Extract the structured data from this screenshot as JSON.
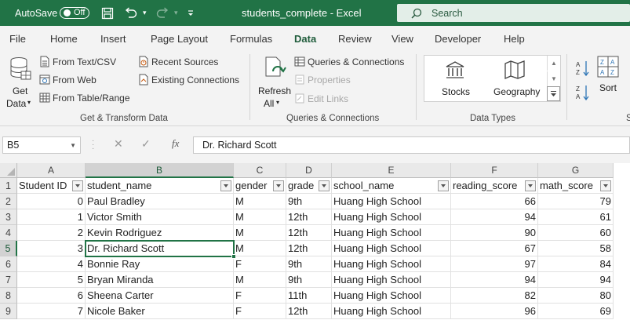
{
  "titlebar": {
    "autosave_label": "AutoSave",
    "autosave_state": "Off",
    "doc_title": "students_complete  -  Excel",
    "search_placeholder": "Search"
  },
  "tabs": [
    "File",
    "Home",
    "Insert",
    "Page Layout",
    "Formulas",
    "Data",
    "Review",
    "View",
    "Developer",
    "Help"
  ],
  "active_tab": "Data",
  "ribbon": {
    "get_data": {
      "line1": "Get",
      "line2": "Data"
    },
    "from_text_csv": "From Text/CSV",
    "from_web": "From Web",
    "from_table_range": "From Table/Range",
    "recent_sources": "Recent Sources",
    "existing_connections": "Existing Connections",
    "group_get_transform": "Get & Transform Data",
    "refresh": {
      "line1": "Refresh",
      "line2": "All"
    },
    "queries_connections": "Queries & Connections",
    "properties": "Properties",
    "edit_links": "Edit Links",
    "group_queries": "Queries & Connections",
    "stocks": "Stocks",
    "geography": "Geography",
    "group_datatypes": "Data Types",
    "sort": "Sort",
    "group_sort_partial": "S"
  },
  "formula_bar": {
    "name_box": "B5",
    "fx": "fx",
    "content": "Dr. Richard Scott"
  },
  "grid": {
    "columns": [
      "A",
      "B",
      "C",
      "D",
      "E",
      "F",
      "G"
    ],
    "selected_column": "B",
    "selected_row": "5",
    "row_numbers": [
      "1",
      "2",
      "3",
      "4",
      "5",
      "6",
      "7",
      "8",
      "9"
    ],
    "headers": [
      "Student ID",
      "student_name",
      "gender",
      "grade",
      "school_name",
      "reading_score",
      "math_score"
    ],
    "rows": [
      [
        "0",
        "Paul Bradley",
        "M",
        "9th",
        "Huang High School",
        "66",
        "79"
      ],
      [
        "1",
        "Victor Smith",
        "M",
        "12th",
        "Huang High School",
        "94",
        "61"
      ],
      [
        "2",
        "Kevin Rodriguez",
        "M",
        "12th",
        "Huang High School",
        "90",
        "60"
      ],
      [
        "3",
        "Dr. Richard Scott",
        "M",
        "12th",
        "Huang High School",
        "67",
        "58"
      ],
      [
        "4",
        "Bonnie Ray",
        "F",
        "9th",
        "Huang High School",
        "97",
        "84"
      ],
      [
        "5",
        "Bryan Miranda",
        "M",
        "9th",
        "Huang High School",
        "94",
        "94"
      ],
      [
        "6",
        "Sheena Carter",
        "F",
        "11th",
        "Huang High School",
        "82",
        "80"
      ],
      [
        "7",
        "Nicole Baker",
        "F",
        "12th",
        "Huang High School",
        "96",
        "69"
      ]
    ]
  },
  "colors": {
    "brand": "#217346",
    "ribbon_bg": "#f3f3f3",
    "header_bg": "#e9e9e9"
  }
}
